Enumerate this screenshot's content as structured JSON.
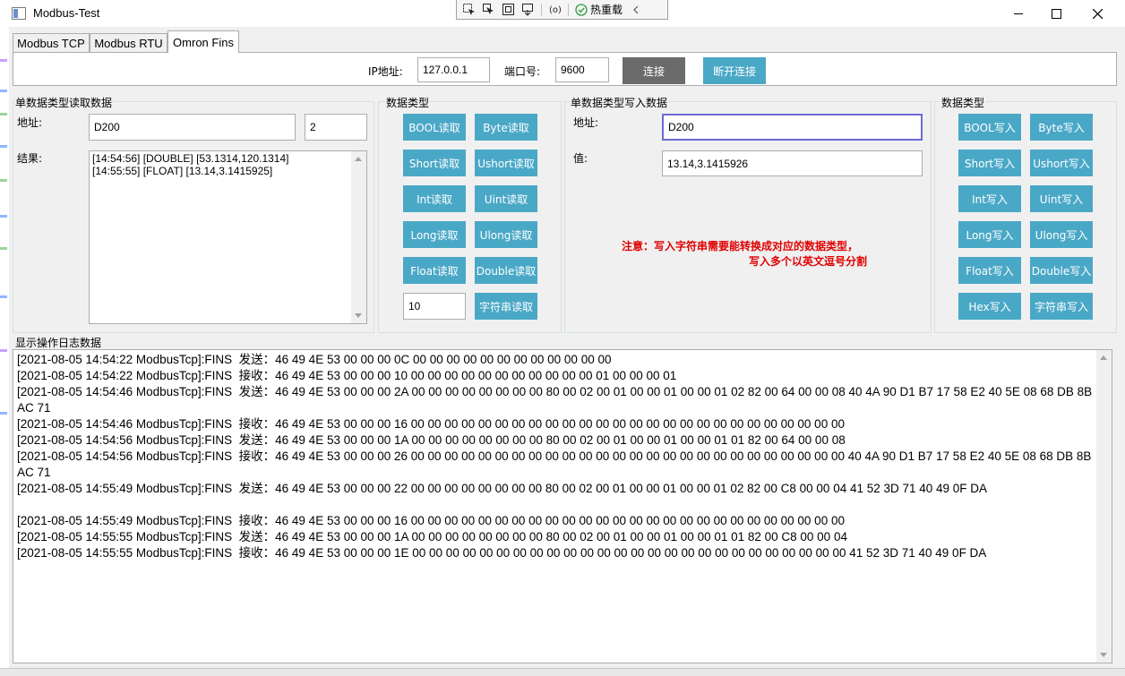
{
  "window": {
    "title": "Modbus-Test"
  },
  "hot_toolbar": {
    "hot_reload_label": "热重载"
  },
  "tabs": [
    {
      "label": "Modbus TCP"
    },
    {
      "label": "Modbus RTU"
    },
    {
      "label": "Omron Fins"
    }
  ],
  "connection": {
    "ip_label": "IP地址:",
    "ip_value": "127.0.0.1",
    "port_label": "端口号:",
    "port_value": "9600",
    "connect_label": "连接",
    "disconnect_label": "断开连接"
  },
  "read_group": {
    "title": "单数据类型读取数据",
    "address_label": "地址:",
    "address_value": "D200",
    "length_value": "2",
    "result_label": "结果:",
    "results": [
      "[14:54:56] [DOUBLE] [53.1314,120.1314]",
      "[14:55:55] [FLOAT] [13.14,3.1415925]"
    ]
  },
  "read_types": {
    "title": "数据类型",
    "buttons": [
      "BOOL读取",
      "Byte读取",
      "Short读取",
      "Ushort读取",
      "Int读取",
      "Uint读取",
      "Long读取",
      "Ulong读取",
      "Float读取",
      "Double读取"
    ],
    "string_length_value": "10",
    "string_read_label": "字符串读取"
  },
  "write_group": {
    "title": "单数据类型写入数据",
    "address_label": "地址:",
    "address_value": "D200",
    "value_label": "值:",
    "value_value": "13.14,3.1415926",
    "note_line1": "注意：写入字符串需要能转换成对应的数据类型，",
    "note_line2": "写入多个以英文逗号分割"
  },
  "write_types": {
    "title": "数据类型",
    "buttons": [
      "BOOL写入",
      "Byte写入",
      "Short写入",
      "Ushort写入",
      "Int写入",
      "Uint写入",
      "Long写入",
      "Ulong写入",
      "Float写入",
      "Double写入",
      "Hex写入",
      "字符串写入"
    ]
  },
  "log": {
    "title": "显示操作日志数据",
    "lines": [
      "[2021-08-05 14:54:22 ModbusTcp]:FINS  发送：46 49 4E 53 00 00 00 0C 00 00 00 00 00 00 00 00 00 00 00 00",
      "[2021-08-05 14:54:22 ModbusTcp]:FINS  接收：46 49 4E 53 00 00 00 10 00 00 00 00 00 00 00 00 00 00 00 01 00 00 00 01",
      "[2021-08-05 14:54:46 ModbusTcp]:FINS  发送：46 49 4E 53 00 00 00 2A 00 00 00 00 00 00 00 00 80 00 02 00 01 00 00 01 00 00 01 02 82 00 64 00 00 08 40 4A 90 D1 B7 17 58 E2 40 5E 08 68 DB 8B AC 71",
      "[2021-08-05 14:54:46 ModbusTcp]:FINS  接收：46 49 4E 53 00 00 00 16 00 00 00 00 00 00 00 00 00 00 00 00 00 00 00 00 00 00 00 00 00 00 00 00 00 00",
      "[2021-08-05 14:54:56 ModbusTcp]:FINS  发送：46 49 4E 53 00 00 00 1A 00 00 00 00 00 00 00 00 80 00 02 00 01 00 00 01 00 00 01 01 82 00 64 00 00 08",
      "[2021-08-05 14:54:56 ModbusTcp]:FINS  接收：46 49 4E 53 00 00 00 26 00 00 00 00 00 00 00 00 00 00 00 00 00 00 00 00 00 00 00 00 00 00 00 00 00 00 40 4A 90 D1 B7 17 58 E2 40 5E 08 68 DB 8B AC 71",
      "[2021-08-05 14:55:49 ModbusTcp]:FINS  发送：46 49 4E 53 00 00 00 22 00 00 00 00 00 00 00 00 80 00 02 00 01 00 00 01 00 00 01 02 82 00 C8 00 00 04 41 52 3D 71 40 49 0F DA",
      "",
      "[2021-08-05 14:55:49 ModbusTcp]:FINS  接收：46 49 4E 53 00 00 00 16 00 00 00 00 00 00 00 00 00 00 00 00 00 00 00 00 00 00 00 00 00 00 00 00 00 00",
      "[2021-08-05 14:55:55 ModbusTcp]:FINS  发送：46 49 4E 53 00 00 00 1A 00 00 00 00 00 00 00 00 80 00 02 00 01 00 00 01 00 00 01 01 82 00 C8 00 00 04",
      "[2021-08-05 14:55:55 ModbusTcp]:FINS  接收：46 49 4E 53 00 00 00 1E 00 00 00 00 00 00 00 00 00 00 00 00 00 00 00 00 00 00 00 00 00 00 00 00 00 00 41 52 3D 71 40 49 0F DA"
    ]
  },
  "colors": {
    "button_blue": "#4aa8c7",
    "button_gray": "#6b6b6b",
    "note_red": "#e00000",
    "focus_border": "#6b6bd6"
  }
}
